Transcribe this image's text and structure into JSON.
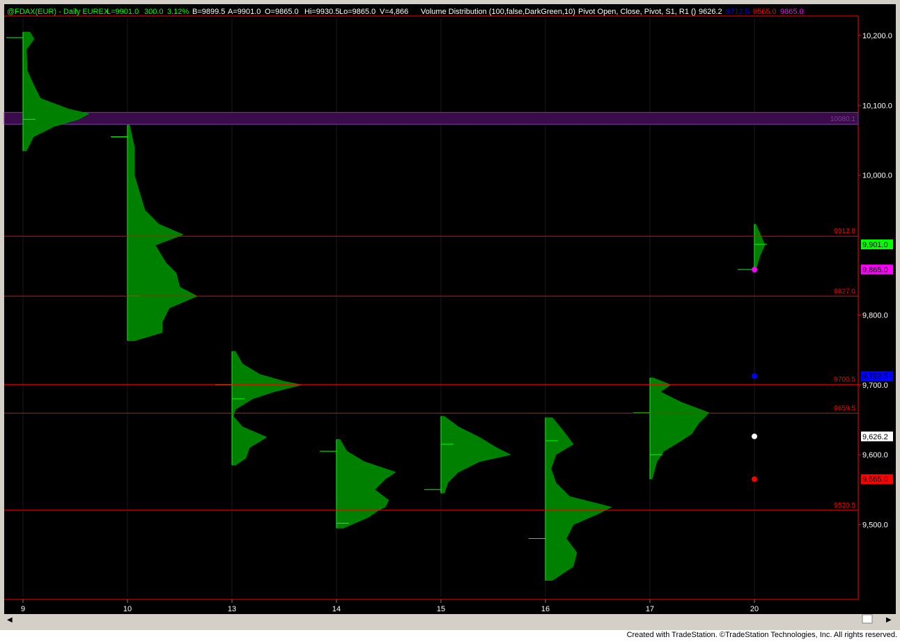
{
  "header": {
    "symbol": "@FDAX(EUR) - Daily  EUREX",
    "last": "L=9901.0",
    "change": "300.0",
    "change_pct": "3.12%",
    "bid": "B=9899.5",
    "ask": "A=9901.0",
    "open": "O=9865.0",
    "high": "Hi=9930.5",
    "low": "Lo=9865.0",
    "volume": "V=4,866",
    "study1": "Volume Distribution (100,false,DarkGreen,10)",
    "study2": "Pivot Open, Close, Pivot, S1, R1 ()",
    "study2_values": [
      "9626.2",
      "9712.5",
      "9565.0",
      "9865.0"
    ]
  },
  "footer": "Created with TradeStation. ©TradeStation Technologies, Inc. All rights reserved.",
  "colors": {
    "background": "#000000",
    "profile": "#008000",
    "marker": "#00ff00",
    "level": "#ff0000",
    "poc_band": "#3a0d4a",
    "text": "#ffffff"
  },
  "chart_data": {
    "type": "bar",
    "subtype": "volume-profile",
    "ylim": [
      9400,
      10230
    ],
    "yticks": [
      {
        "value": 10200,
        "label": "10,200.0"
      },
      {
        "value": 10100,
        "label": "10,100.0"
      },
      {
        "value": 10000,
        "label": "10,000.0"
      },
      {
        "value": 9800,
        "label": "9,800.0"
      },
      {
        "value": 9700,
        "label": "9,700.0"
      },
      {
        "value": 9600,
        "label": "9,600.0"
      },
      {
        "value": 9500,
        "label": "9,500.0"
      }
    ],
    "categories": [
      "9",
      "10",
      "13",
      "14",
      "15",
      "16",
      "17",
      "20"
    ],
    "profiles": [
      {
        "day": "9",
        "low": 10035,
        "high": 10205,
        "open": 10197,
        "close": 10080,
        "shape": [
          [
            10205,
            0.1
          ],
          [
            10195,
            0.16
          ],
          [
            10180,
            0.05
          ],
          [
            10150,
            0.06
          ],
          [
            10130,
            0.15
          ],
          [
            10110,
            0.25
          ],
          [
            10095,
            0.65
          ],
          [
            10088,
            0.95
          ],
          [
            10080,
            0.8
          ],
          [
            10070,
            0.45
          ],
          [
            10055,
            0.15
          ],
          [
            10035,
            0.05
          ]
        ]
      },
      {
        "day": "10",
        "low": 9763,
        "high": 10072,
        "open": 10055,
        "close": 9827,
        "shape": [
          [
            10072,
            0.03
          ],
          [
            10040,
            0.1
          ],
          [
            10000,
            0.1
          ],
          [
            9950,
            0.25
          ],
          [
            9930,
            0.45
          ],
          [
            9915,
            0.8
          ],
          [
            9900,
            0.4
          ],
          [
            9875,
            0.55
          ],
          [
            9860,
            0.7
          ],
          [
            9840,
            0.75
          ],
          [
            9827,
            1.0
          ],
          [
            9810,
            0.6
          ],
          [
            9790,
            0.5
          ],
          [
            9775,
            0.5
          ],
          [
            9763,
            0.1
          ]
        ]
      },
      {
        "day": "13",
        "low": 9585,
        "high": 9748,
        "open": 9700,
        "close": 9680,
        "shape": [
          [
            9748,
            0.05
          ],
          [
            9730,
            0.15
          ],
          [
            9715,
            0.4
          ],
          [
            9705,
            0.75
          ],
          [
            9700,
            1.0
          ],
          [
            9690,
            0.6
          ],
          [
            9680,
            0.3
          ],
          [
            9665,
            0.05
          ],
          [
            9655,
            0.02
          ],
          [
            9640,
            0.15
          ],
          [
            9625,
            0.5
          ],
          [
            9610,
            0.25
          ],
          [
            9595,
            0.2
          ],
          [
            9585,
            0.05
          ]
        ]
      },
      {
        "day": "14",
        "low": 9495,
        "high": 9622,
        "open": 9605,
        "close": 9502,
        "shape": [
          [
            9622,
            0.05
          ],
          [
            9605,
            0.15
          ],
          [
            9590,
            0.4
          ],
          [
            9575,
            0.85
          ],
          [
            9565,
            0.7
          ],
          [
            9550,
            0.55
          ],
          [
            9535,
            0.75
          ],
          [
            9525,
            0.7
          ],
          [
            9520,
            0.6
          ],
          [
            9510,
            0.45
          ],
          [
            9495,
            0.1
          ]
        ]
      },
      {
        "day": "15",
        "low": 9545,
        "high": 9655,
        "open": 9550,
        "close": 9615,
        "shape": [
          [
            9655,
            0.05
          ],
          [
            9640,
            0.25
          ],
          [
            9625,
            0.55
          ],
          [
            9610,
            0.8
          ],
          [
            9600,
            1.0
          ],
          [
            9590,
            0.55
          ],
          [
            9575,
            0.25
          ],
          [
            9560,
            0.1
          ],
          [
            9545,
            0.05
          ]
        ]
      },
      {
        "day": "16",
        "low": 9420,
        "high": 9653,
        "open": 9480,
        "close": 9620,
        "shape": [
          [
            9653,
            0.1
          ],
          [
            9635,
            0.25
          ],
          [
            9615,
            0.4
          ],
          [
            9600,
            0.15
          ],
          [
            9580,
            0.08
          ],
          [
            9560,
            0.15
          ],
          [
            9540,
            0.35
          ],
          [
            9525,
            0.95
          ],
          [
            9515,
            0.75
          ],
          [
            9500,
            0.4
          ],
          [
            9480,
            0.3
          ],
          [
            9460,
            0.45
          ],
          [
            9440,
            0.4
          ],
          [
            9420,
            0.1
          ]
        ]
      },
      {
        "day": "17",
        "low": 9565,
        "high": 9710,
        "open": 9660,
        "close": 9600,
        "shape": [
          [
            9710,
            0.05
          ],
          [
            9700,
            0.3
          ],
          [
            9690,
            0.15
          ],
          [
            9675,
            0.45
          ],
          [
            9660,
            0.85
          ],
          [
            9645,
            0.7
          ],
          [
            9630,
            0.6
          ],
          [
            9620,
            0.45
          ],
          [
            9605,
            0.2
          ],
          [
            9590,
            0.1
          ],
          [
            9565,
            0.03
          ]
        ]
      },
      {
        "day": "20",
        "low": 9865,
        "high": 9930,
        "open": 9865,
        "close": 9901,
        "shape": [
          [
            9930,
            0.02
          ],
          [
            9912,
            0.1
          ],
          [
            9900,
            0.15
          ],
          [
            9885,
            0.08
          ],
          [
            9865,
            0.02
          ]
        ]
      }
    ],
    "levels": [
      {
        "value": 9912.8,
        "label": "9912.8"
      },
      {
        "value": 9827.0,
        "label": "9827.0"
      },
      {
        "value": 9700.5,
        "label": "9700.5"
      },
      {
        "value": 9659.5,
        "label": "9659.5"
      },
      {
        "value": 9520.5,
        "label": "9520.5"
      }
    ],
    "poc_band": {
      "low": 10073,
      "high": 10090,
      "label": "10080.1"
    },
    "pivot_dots": [
      {
        "value": 9865.0,
        "color": "#ff00ff"
      },
      {
        "value": 9712.5,
        "color": "#0000ff"
      },
      {
        "value": 9626.2,
        "color": "#ffffff"
      },
      {
        "value": 9565.0,
        "color": "#ff0000"
      }
    ],
    "price_badges": [
      {
        "value": 9901.0,
        "label": "9,901.0",
        "bg": "#00ff00",
        "fg": "#000000"
      },
      {
        "value": 9865.0,
        "label": "9,865.0",
        "bg": "#ff00ff",
        "fg": "#000000"
      },
      {
        "value": 9712.5,
        "label": "9,712.5",
        "bg": "#0000ff",
        "fg": "#000000"
      },
      {
        "value": 9626.2,
        "label": "9,626.2",
        "bg": "#ffffff",
        "fg": "#000000"
      },
      {
        "value": 9565.0,
        "label": "9,565.0",
        "bg": "#ff0000",
        "fg": "#000000"
      }
    ]
  }
}
